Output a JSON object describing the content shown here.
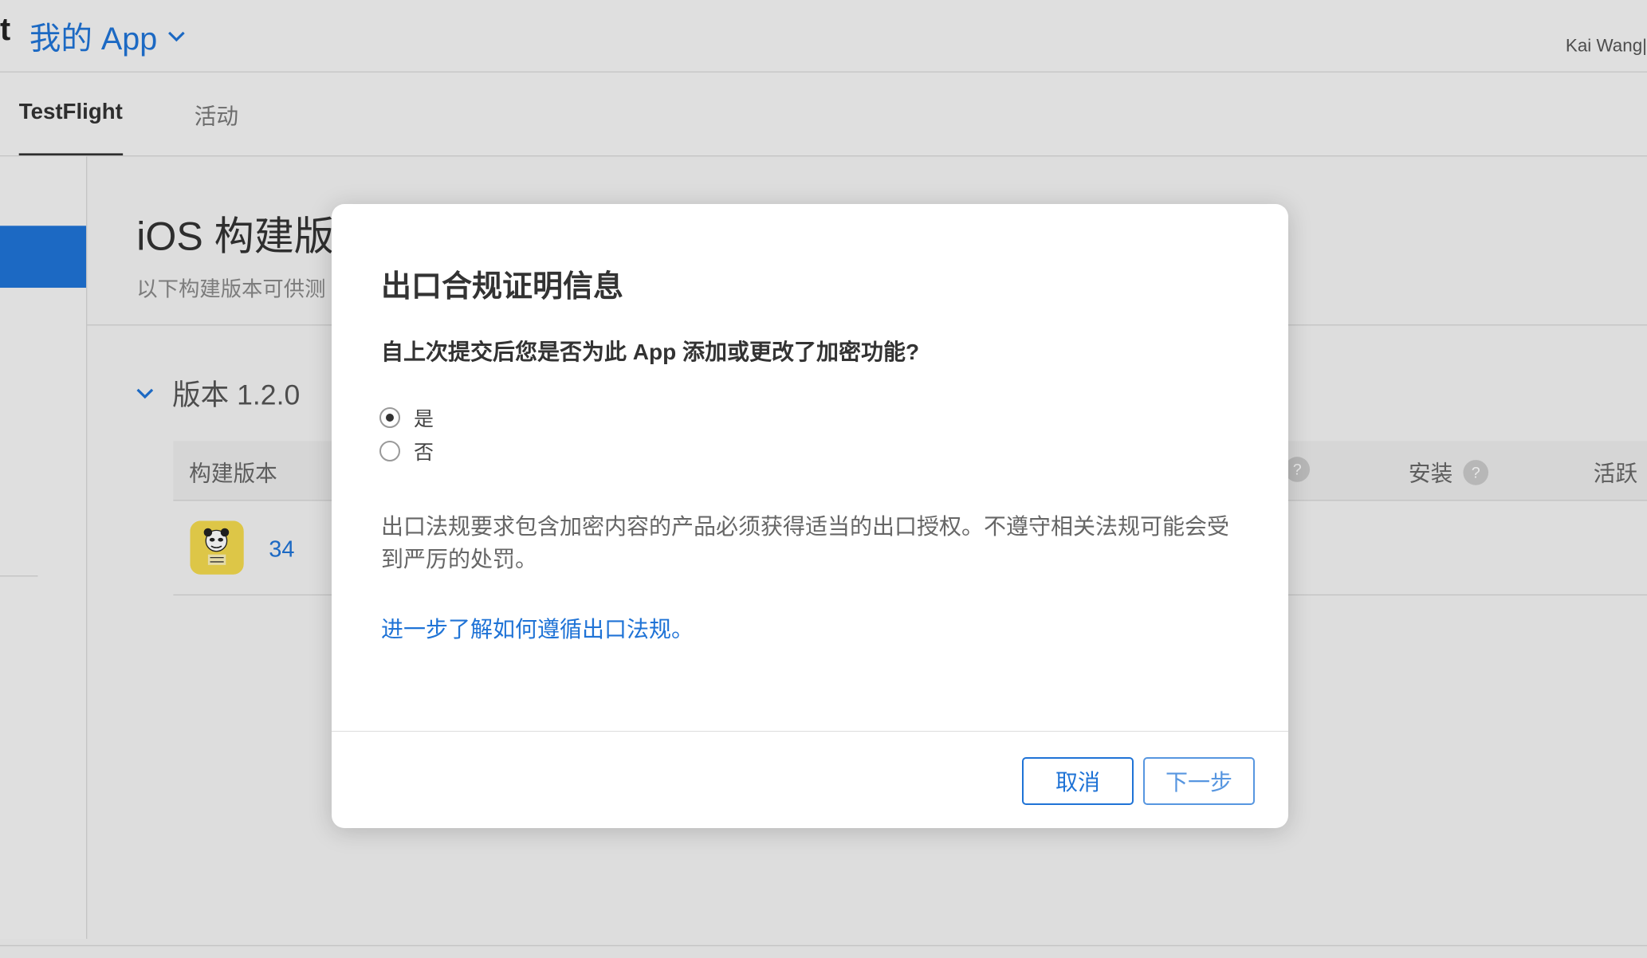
{
  "header": {
    "brand_fragment": "t",
    "app_selector_label": "我的 App",
    "user_name": "Kai Wang|"
  },
  "tabs": [
    {
      "label": "TestFlight",
      "active": true
    },
    {
      "label": "活动",
      "active": false
    }
  ],
  "page": {
    "title": "iOS 构建版",
    "subtitle": "以下构建版本可供测"
  },
  "version_group": {
    "label": "版本 1.2.0",
    "expanded": true
  },
  "table": {
    "columns": [
      {
        "label": "构建版本",
        "help": false
      },
      {
        "label": "",
        "help": true
      },
      {
        "label": "安装",
        "help": true
      },
      {
        "label": "活跃",
        "help": false
      }
    ],
    "rows": [
      {
        "build": "34"
      }
    ]
  },
  "dialog": {
    "title": "出口合规证明信息",
    "question": "自上次提交后您是否为此 App 添加或更改了加密功能?",
    "options": [
      {
        "label": "是",
        "selected": true
      },
      {
        "label": "否",
        "selected": false
      }
    ],
    "description": "出口法规要求包含加密内容的产品必须获得适当的出口授权。不遵守相关法规可能会受到严厉的处罚。",
    "link_text": "进一步了解如何遵循出口法规。",
    "cancel_label": "取消",
    "next_label": "下一步"
  },
  "colors": {
    "accent": "#1f73d6",
    "app_icon_bg": "#f2d94e"
  }
}
